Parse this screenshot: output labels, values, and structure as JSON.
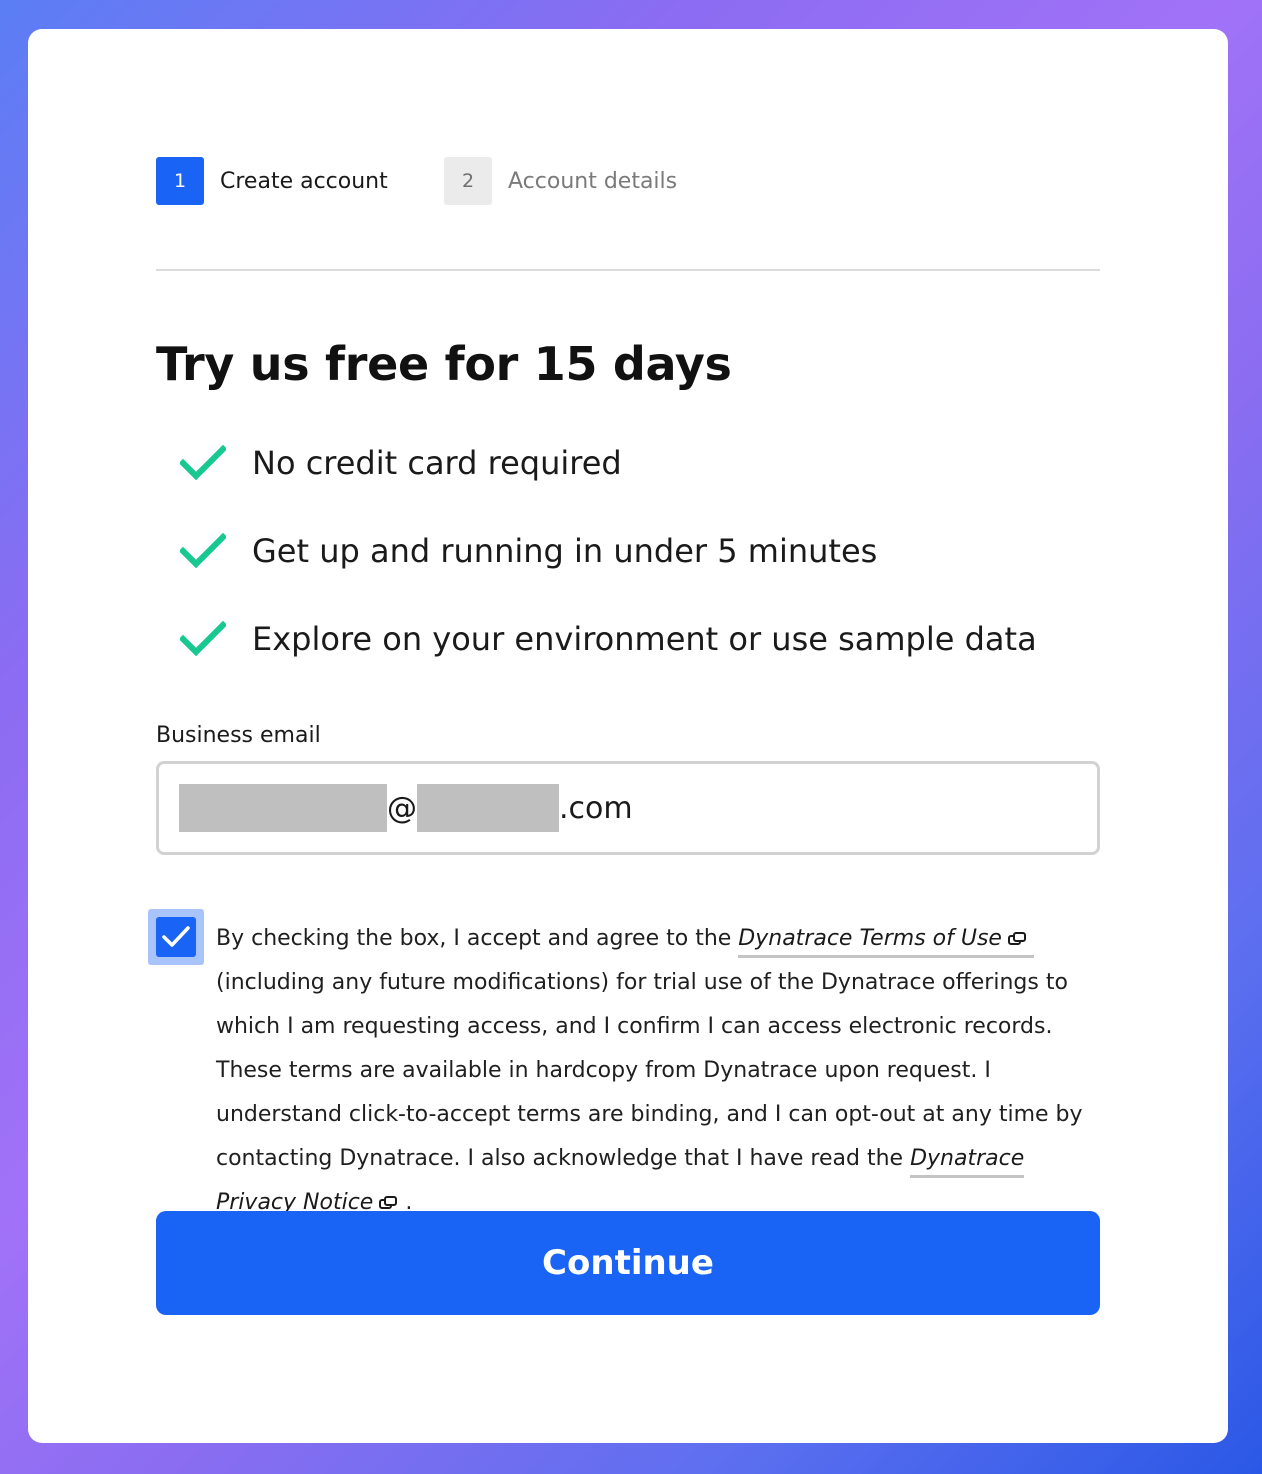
{
  "stepper": {
    "steps": [
      {
        "number": "1",
        "label": "Create account",
        "state": "active"
      },
      {
        "number": "2",
        "label": "Account details",
        "state": "inactive"
      }
    ]
  },
  "headline": "Try us free for 15 days",
  "benefits": [
    {
      "icon": "check-icon",
      "text": "No credit card required"
    },
    {
      "icon": "check-icon",
      "text": "Get up and running in under 5 minutes"
    },
    {
      "icon": "check-icon",
      "text": "Explore on your environment or use sample data"
    }
  ],
  "email": {
    "label": "Business email",
    "value_visible_part_1": "@",
    "value_visible_part_2": ".com",
    "value_redacted": true
  },
  "consent": {
    "checked": true,
    "text_before_terms": "By checking the box, I accept and agree to the",
    "terms_link": "Dynatrace Terms of Use",
    "text_middle": "(including any future modifications) for trial use of the Dynatrace offerings to which I am requesting access, and I confirm I can access electronic records. These terms are available in hardcopy from Dynatrace upon request. I understand click-to-accept terms are binding, and I can opt-out at any time by contacting Dynatrace. I also acknowledge that I have read the",
    "privacy_link": "Dynatrace Privacy Notice",
    "text_after": "."
  },
  "continue_label": "Continue",
  "colors": {
    "primary": "#1963f5",
    "check_green": "#17c98f",
    "step_inactive_bg": "#ebebeb"
  }
}
